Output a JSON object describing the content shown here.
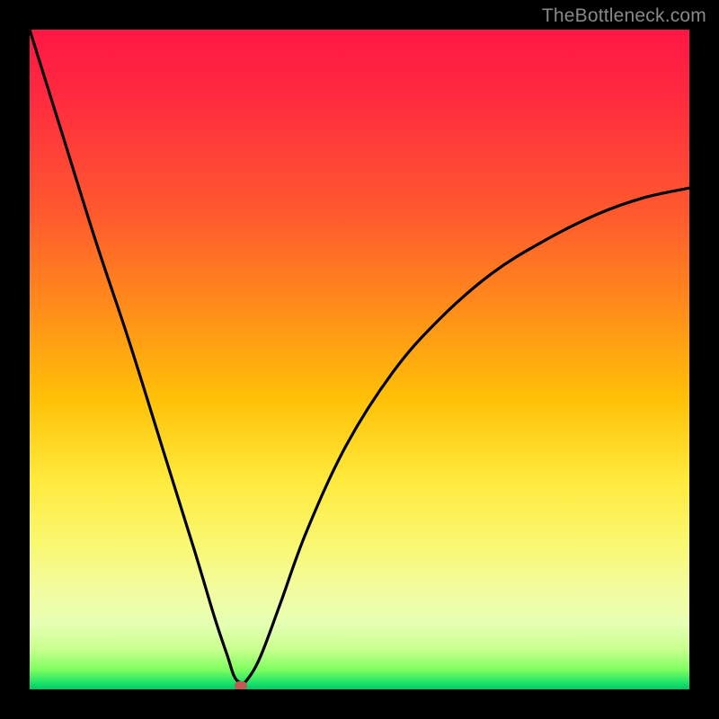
{
  "watermark": "TheBottleneck.com",
  "colors": {
    "frame": "#000000",
    "gradient_top": "#ff1744",
    "gradient_bottom": "#00c864",
    "curve": "#000000",
    "marker": "#c05a52"
  },
  "chart_data": {
    "type": "line",
    "title": "",
    "xlabel": "",
    "ylabel": "",
    "xlim": [
      0,
      100
    ],
    "ylim": [
      0,
      100
    ],
    "x": [
      0,
      5,
      10,
      15,
      20,
      25,
      28,
      30,
      31,
      32,
      33,
      35,
      38,
      42,
      48,
      55,
      62,
      70,
      78,
      86,
      93,
      100
    ],
    "values": [
      100,
      84,
      68,
      53,
      37,
      21,
      11,
      5,
      2,
      1,
      1.5,
      5,
      13,
      24,
      37,
      48,
      56,
      63,
      68,
      72,
      74.5,
      76
    ],
    "marker": {
      "x": 32,
      "y": 0.5
    },
    "notes": "V-shaped bottleneck curve; minimum near x≈32. Background gradient encodes severity from red (high) at top to green (low) at bottom. No axis ticks or numeric labels are visible."
  }
}
